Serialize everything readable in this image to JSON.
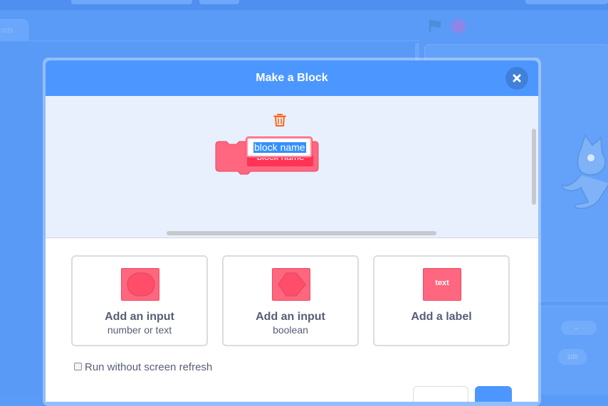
{
  "background": {
    "tab_fragment": "nds",
    "chip_value": "100"
  },
  "modal": {
    "title": "Make a Block",
    "block_name_value": "block name",
    "block_name_ghost": "block name",
    "options": [
      {
        "title": "Add an input",
        "subtitle": "number or text",
        "icon": "number-input-shape-icon"
      },
      {
        "title": "Add an input",
        "subtitle": "boolean",
        "icon": "boolean-input-shape-icon"
      },
      {
        "title": "Add a label",
        "subtitle": "",
        "icon": "label-shape-icon",
        "icon_text": "text"
      }
    ],
    "run_without_refresh_label": "Run without screen refresh",
    "run_without_refresh_checked": false
  },
  "colors": {
    "header": "#4c97ff",
    "block": "#ff6680",
    "block_border": "#e64d62",
    "text": "#575e75",
    "workspace": "#e8f0fe"
  }
}
